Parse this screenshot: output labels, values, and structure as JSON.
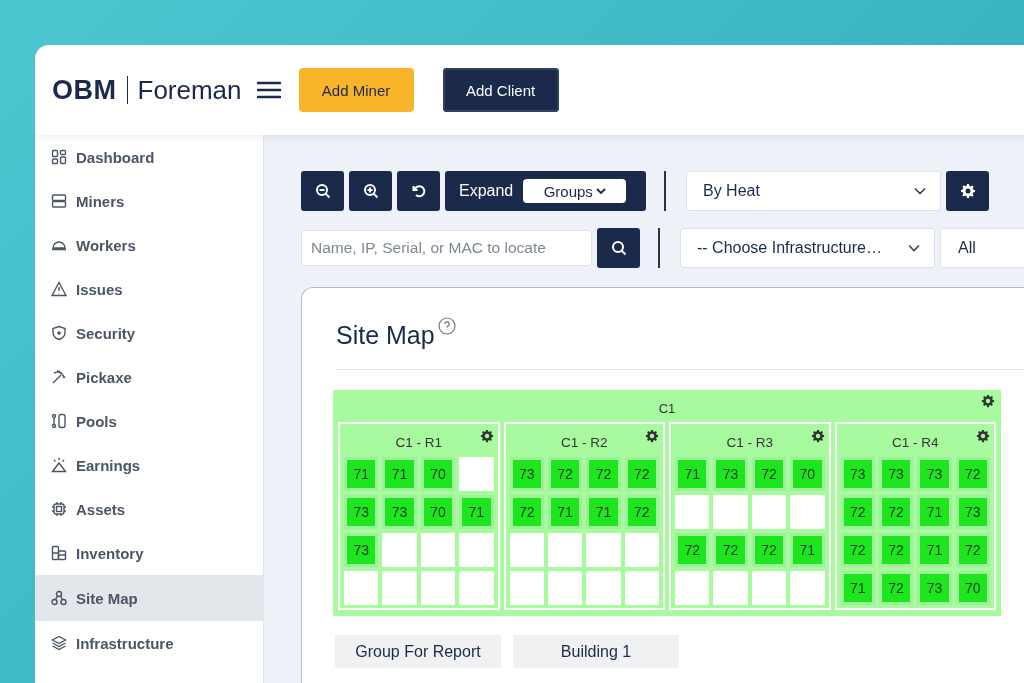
{
  "header": {
    "logo_mark": "OBM",
    "logo_name": "Foreman",
    "buttons": [
      {
        "label": "Add Miner",
        "kind": "primary"
      },
      {
        "label": "Add Client",
        "kind": "dark"
      }
    ]
  },
  "sidebar": {
    "items": [
      {
        "label": "Dashboard",
        "kind": "dashboard",
        "selected": false
      },
      {
        "label": "Miners",
        "kind": "miners",
        "selected": false
      },
      {
        "label": "Workers",
        "kind": "workers",
        "selected": false
      },
      {
        "label": "Issues",
        "kind": "issues",
        "selected": false
      },
      {
        "label": "Security",
        "kind": "security",
        "selected": false
      },
      {
        "label": "Pickaxe",
        "kind": "pickaxe",
        "selected": false
      },
      {
        "label": "Pools",
        "kind": "pools",
        "selected": false
      },
      {
        "label": "Earnings",
        "kind": "earnings",
        "selected": false
      },
      {
        "label": "Assets",
        "kind": "assets",
        "selected": false
      },
      {
        "label": "Inventory",
        "kind": "inventory",
        "selected": false
      },
      {
        "label": "Site Map",
        "kind": "sitemap",
        "selected": true
      },
      {
        "label": "Infrastructure",
        "kind": "infrastructure",
        "selected": false
      }
    ]
  },
  "toolbar": {
    "expand_label": "Expand",
    "expand_value": "Groups",
    "view_select": "By Heat",
    "search": {
      "placeholder": "Name, IP, Serial, or MAC to locate"
    },
    "infrastructure_select": "-- Choose Infrastructure…",
    "filter_select": "All"
  },
  "site_map": {
    "title": "Site Map",
    "container": {
      "name": "C1",
      "racks": [
        {
          "name": "C1 - R1",
          "cells": [
            {
              "kind": "miner",
              "reading": "71"
            },
            {
              "kind": "miner",
              "reading": "71"
            },
            {
              "kind": "miner",
              "reading": "70"
            },
            {
              "kind": "empty"
            },
            {
              "kind": "miner",
              "reading": "73"
            },
            {
              "kind": "miner",
              "reading": "73"
            },
            {
              "kind": "miner",
              "reading": "70"
            },
            {
              "kind": "miner",
              "reading": "71"
            },
            {
              "kind": "miner",
              "reading": "73"
            },
            {
              "kind": "empty"
            },
            {
              "kind": "empty"
            },
            {
              "kind": "empty"
            },
            {
              "kind": "empty"
            },
            {
              "kind": "empty"
            },
            {
              "kind": "empty"
            },
            {
              "kind": "empty"
            }
          ]
        },
        {
          "name": "C1 - R2",
          "cells": [
            {
              "kind": "miner",
              "reading": "73"
            },
            {
              "kind": "miner",
              "reading": "72"
            },
            {
              "kind": "miner",
              "reading": "72"
            },
            {
              "kind": "miner",
              "reading": "72"
            },
            {
              "kind": "miner",
              "reading": "72"
            },
            {
              "kind": "miner",
              "reading": "71"
            },
            {
              "kind": "miner",
              "reading": "71"
            },
            {
              "kind": "miner",
              "reading": "72"
            },
            {
              "kind": "empty"
            },
            {
              "kind": "empty"
            },
            {
              "kind": "empty"
            },
            {
              "kind": "empty"
            },
            {
              "kind": "empty"
            },
            {
              "kind": "empty"
            },
            {
              "kind": "empty"
            },
            {
              "kind": "empty"
            }
          ]
        },
        {
          "name": "C1 - R3",
          "cells": [
            {
              "kind": "miner",
              "reading": "71"
            },
            {
              "kind": "miner",
              "reading": "73"
            },
            {
              "kind": "miner",
              "reading": "72"
            },
            {
              "kind": "miner",
              "reading": "70"
            },
            {
              "kind": "empty"
            },
            {
              "kind": "empty"
            },
            {
              "kind": "empty"
            },
            {
              "kind": "empty"
            },
            {
              "kind": "miner",
              "reading": "72"
            },
            {
              "kind": "miner",
              "reading": "72"
            },
            {
              "kind": "miner",
              "reading": "72"
            },
            {
              "kind": "miner",
              "reading": "71"
            },
            {
              "kind": "empty"
            },
            {
              "kind": "empty"
            },
            {
              "kind": "empty"
            },
            {
              "kind": "empty"
            }
          ]
        },
        {
          "name": "C1 - R4",
          "cells": [
            {
              "kind": "miner",
              "reading": "73"
            },
            {
              "kind": "miner",
              "reading": "73"
            },
            {
              "kind": "miner",
              "reading": "73"
            },
            {
              "kind": "miner",
              "reading": "72"
            },
            {
              "kind": "miner",
              "reading": "72"
            },
            {
              "kind": "miner",
              "reading": "72"
            },
            {
              "kind": "miner",
              "reading": "71"
            },
            {
              "kind": "miner",
              "reading": "73"
            },
            {
              "kind": "miner",
              "reading": "72"
            },
            {
              "kind": "miner",
              "reading": "72"
            },
            {
              "kind": "miner",
              "reading": "71"
            },
            {
              "kind": "miner",
              "reading": "72"
            },
            {
              "kind": "miner",
              "reading": "71"
            },
            {
              "kind": "miner",
              "reading": "72"
            },
            {
              "kind": "miner",
              "reading": "73"
            },
            {
              "kind": "miner",
              "reading": "70"
            }
          ]
        }
      ]
    },
    "groups": [
      "Group For Report",
      "Building 1"
    ]
  }
}
